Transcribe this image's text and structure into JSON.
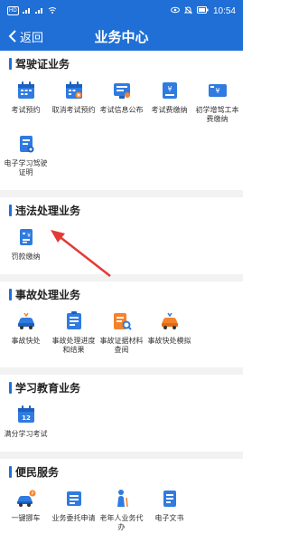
{
  "status_bar": {
    "network": "HD",
    "signal": "4G",
    "wifi": "wifi",
    "battery": "battery",
    "time": "10:54"
  },
  "nav": {
    "back_label": "返回",
    "title": "业务中心"
  },
  "colors": {
    "primary": "#1f6fd6",
    "accent_orange": "#f5822a",
    "arrow": "#e53935"
  },
  "sections": [
    {
      "title": "驾驶证业务",
      "items": [
        {
          "label": "考试预约",
          "icon": "calendar-icon"
        },
        {
          "label": "取消考试预约",
          "icon": "calendar-cancel-icon"
        },
        {
          "label": "考试信息公布",
          "icon": "info-board-icon"
        },
        {
          "label": "考试费缴纳",
          "icon": "fee-icon"
        },
        {
          "label": "初学增驾工本费缴纳",
          "icon": "fee-card-icon"
        },
        {
          "label": "电子学习驾驶证明",
          "icon": "document-icon"
        }
      ]
    },
    {
      "title": "违法处理业务",
      "items": [
        {
          "label": "罚款缴纳",
          "icon": "fine-icon"
        }
      ]
    },
    {
      "title": "事故处理业务",
      "items": [
        {
          "label": "事故快处",
          "icon": "car-accident-icon"
        },
        {
          "label": "事故处理进度和结果",
          "icon": "progress-doc-icon"
        },
        {
          "label": "事故证据材料查阅",
          "icon": "evidence-search-icon"
        },
        {
          "label": "事故快处模拟",
          "icon": "car-simulation-icon"
        }
      ]
    },
    {
      "title": "学习教育业务",
      "items": [
        {
          "label": "满分学习考试",
          "icon": "calendar-12-icon"
        }
      ]
    },
    {
      "title": "便民服务",
      "items": [
        {
          "label": "一键挪车",
          "icon": "move-car-icon"
        },
        {
          "label": "业务委托申请",
          "icon": "delegate-icon"
        },
        {
          "label": "老年人业务代办",
          "icon": "elderly-icon"
        },
        {
          "label": "电子文书",
          "icon": "e-document-icon"
        }
      ]
    }
  ]
}
